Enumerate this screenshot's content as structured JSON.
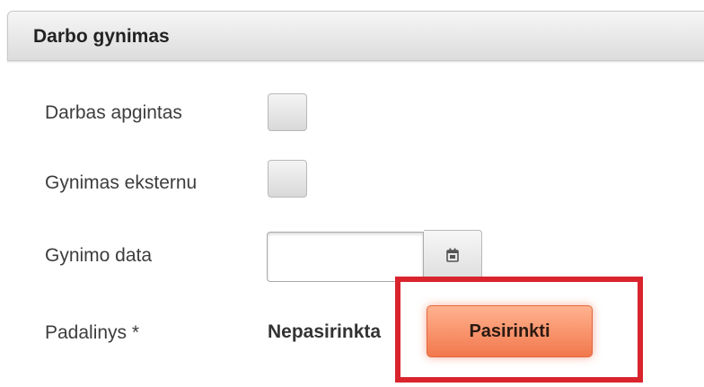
{
  "panel": {
    "title": "Darbo gynimas"
  },
  "fields": {
    "defended": {
      "label": "Darbas apgintas",
      "checked": false
    },
    "external": {
      "label": "Gynimas eksternu",
      "checked": false
    },
    "defense_date": {
      "label": "Gynimo data",
      "value": "",
      "placeholder": ""
    },
    "unit": {
      "label": "Padalinys *",
      "value_text": "Nepasirinkta",
      "button_label": "Pasirinkti"
    }
  },
  "colors": {
    "highlight_border": "#d9232d",
    "button_accent": "#f2784d"
  },
  "icons": {
    "date_picker": "calendar-icon"
  }
}
